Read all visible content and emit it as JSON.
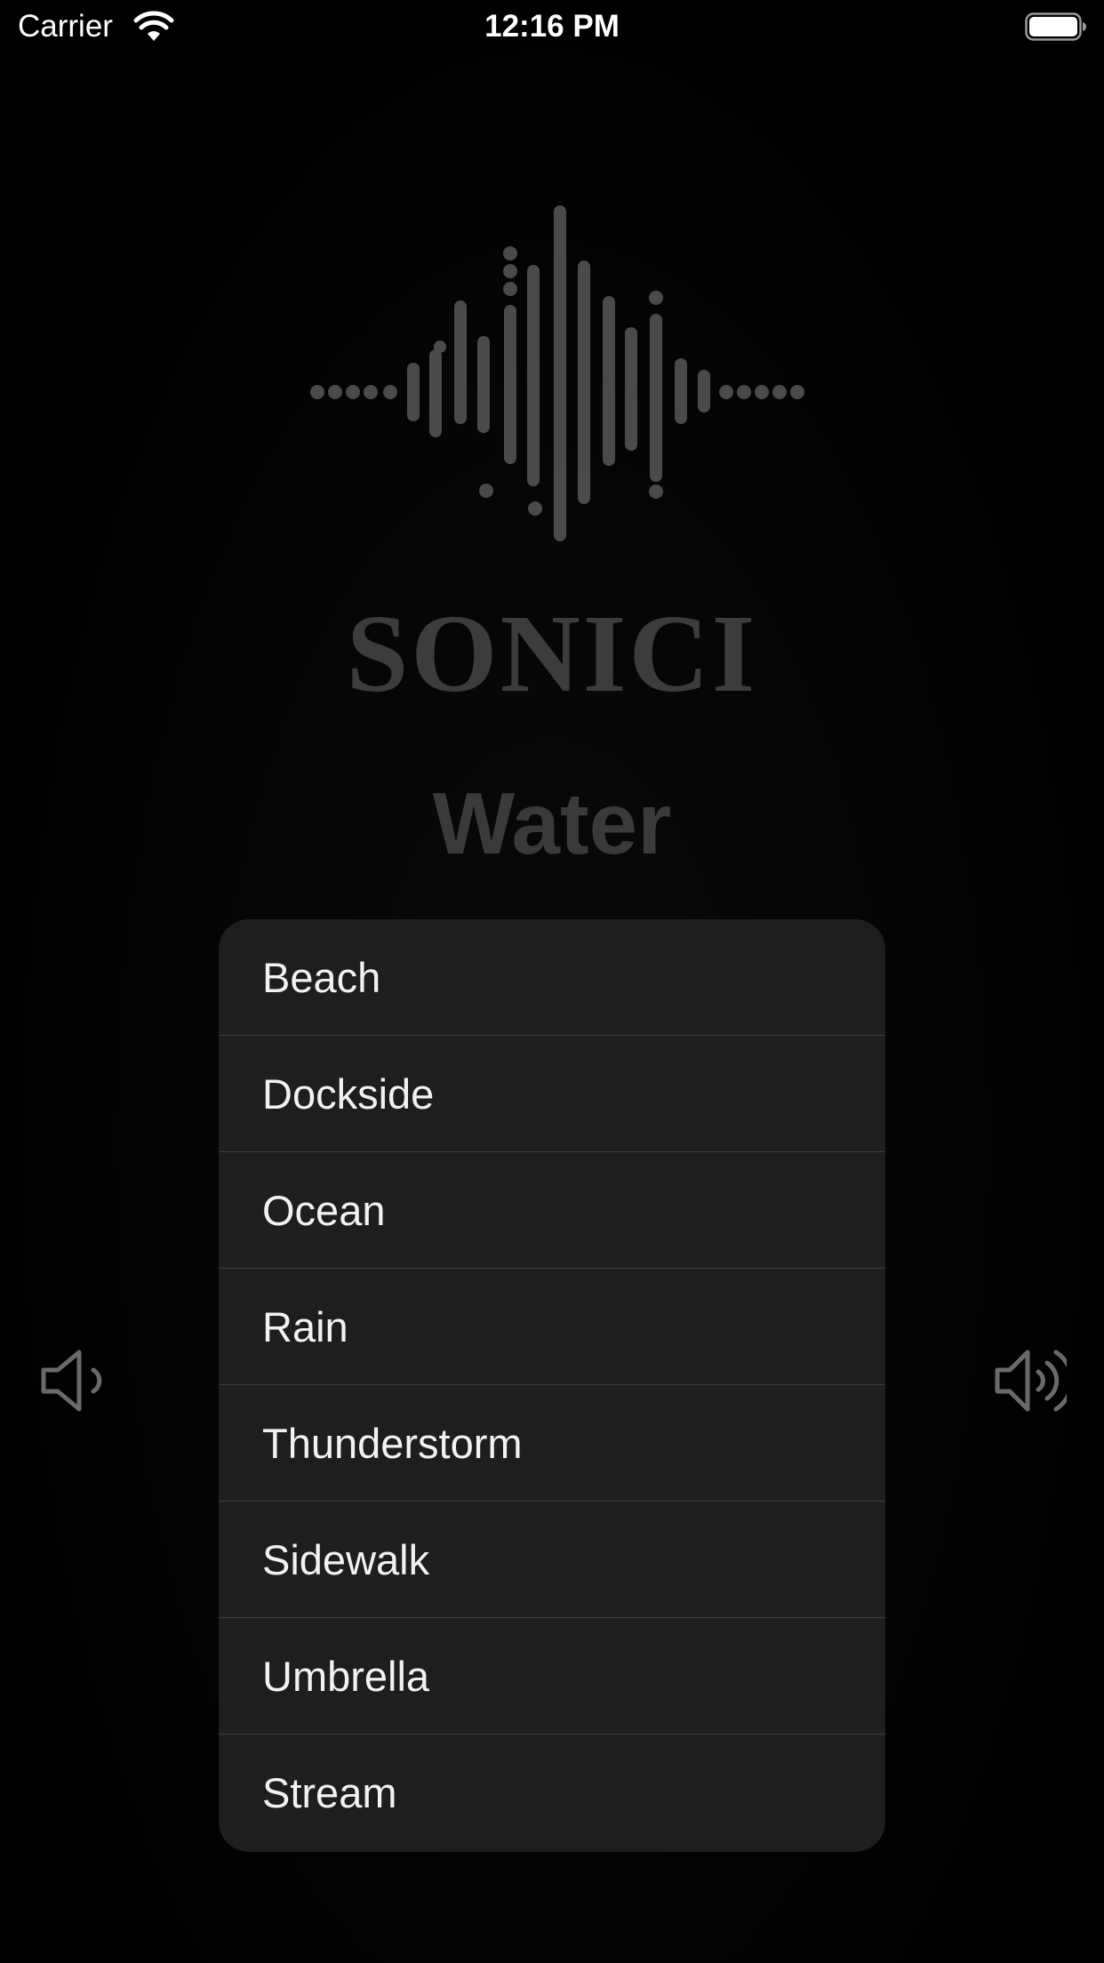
{
  "status_bar": {
    "carrier": "Carrier",
    "time": "12:16 PM",
    "wifi_icon": "wifi-icon",
    "battery_icon": "battery-icon"
  },
  "logo": {
    "icon": "waveform-icon",
    "brand": "SONICI"
  },
  "category": "Water",
  "menu": {
    "items": [
      {
        "label": "Beach"
      },
      {
        "label": "Dockside"
      },
      {
        "label": "Ocean"
      },
      {
        "label": "Rain"
      },
      {
        "label": "Thunderstorm"
      },
      {
        "label": "Sidewalk"
      },
      {
        "label": "Umbrella"
      },
      {
        "label": "Stream"
      }
    ]
  },
  "controls": {
    "volume_low_icon": "speaker-low-icon",
    "volume_high_icon": "speaker-high-icon"
  },
  "colors": {
    "background": "#000000",
    "menu_background": "#1e1e1f",
    "logo_gray": "#3c3c3c"
  }
}
